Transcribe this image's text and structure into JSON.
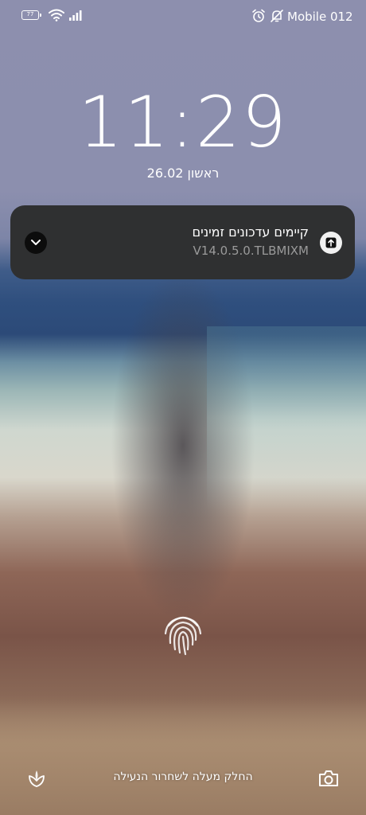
{
  "status_bar": {
    "battery_level": "77",
    "carrier": "Mobile 012"
  },
  "lock_screen": {
    "time": "11:29",
    "date": "ראשון 26.02"
  },
  "notification": {
    "title": "קיימים עדכונים זמינים",
    "subtitle": "V14.0.5.0.TLBMIXM"
  },
  "bottom": {
    "unlock_hint": "החלק מעלה לשחרור הנעילה"
  },
  "icons": {
    "status": [
      "battery-icon",
      "wifi-icon",
      "signal-icon",
      "alarm-icon",
      "mute-icon"
    ],
    "notification": [
      "chevron-down-icon",
      "upload-icon"
    ],
    "bottom": [
      "leaf-icon",
      "camera-icon",
      "fingerprint-icon"
    ]
  },
  "colors": {
    "notification_bg": "#2f3031",
    "notification_subtitle": "#9a9a9a"
  }
}
